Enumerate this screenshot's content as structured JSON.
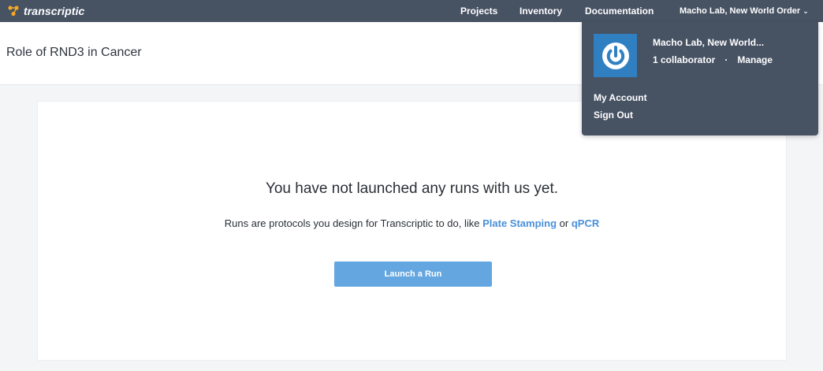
{
  "brand": {
    "name": "transcriptic",
    "logo_color": "#f5a623"
  },
  "nav": {
    "projects": "Projects",
    "inventory": "Inventory",
    "documentation": "Documentation",
    "org": "Macho Lab, New World Order"
  },
  "header": {
    "title": "Role of RND3 in Cancer"
  },
  "empty_state": {
    "title": "You have not launched any runs with us yet.",
    "text_prefix": "Runs are protocols you design for Transcriptic to do, like ",
    "link1": "Plate Stamping",
    "text_middle": " or ",
    "link2": "qPCR",
    "button": "Launch a Run"
  },
  "dropdown": {
    "org_name": "Macho Lab, New World...",
    "collaborators": "1 collaborator",
    "separator": "·",
    "manage": "Manage",
    "my_account": "My Account",
    "sign_out": "Sign Out",
    "avatar_icon": "power-icon",
    "avatar_color": "#2f7fc1"
  },
  "colors": {
    "topbar": "#475263",
    "link": "#4a90d9",
    "button": "#63a6e0"
  }
}
